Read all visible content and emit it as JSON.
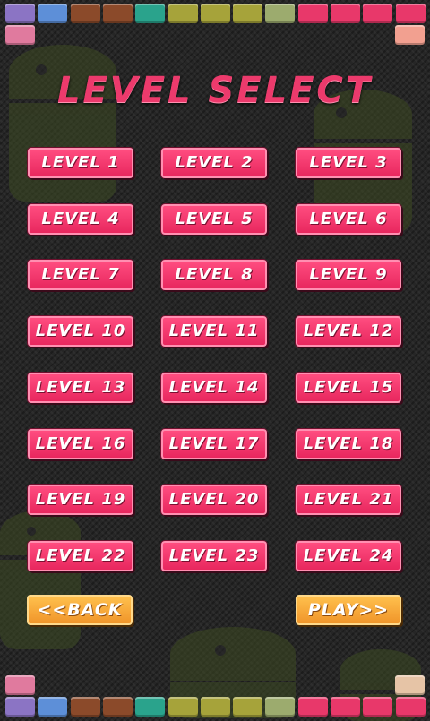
{
  "title": "LEVEL SELECT",
  "levels": [
    "LEVEL 1",
    "LEVEL 2",
    "LEVEL 3",
    "LEVEL 4",
    "LEVEL 5",
    "LEVEL 6",
    "LEVEL 7",
    "LEVEL 8",
    "LEVEL 9",
    "LEVEL 10",
    "LEVEL 11",
    "LEVEL 12",
    "LEVEL 13",
    "LEVEL 14",
    "LEVEL 15",
    "LEVEL 16",
    "LEVEL 17",
    "LEVEL 18",
    "LEVEL 19",
    "LEVEL 20",
    "LEVEL 21",
    "LEVEL 22",
    "LEVEL 23",
    "LEVEL 24"
  ],
  "back_label": "<<BACK",
  "play_label": "PLAY>>",
  "colors": {
    "level_button": "#f23a6e",
    "nav_button": "#f5a63a",
    "title": "#ec3a6c",
    "background": "#262626"
  },
  "brick_colors_top": [
    "#8b74c4",
    "#5d8fd8",
    "#8b4a2a",
    "#8b4a2a",
    "#2aa38c",
    "#a6a33a",
    "#a6a33a",
    "#a6a33a",
    "#9cab6e",
    "#e8386a",
    "#e8386a",
    "#e8386a",
    "#e8386a"
  ],
  "brick_colors_bottom": [
    "#8b74c4",
    "#5d8fd8",
    "#8b4a2a",
    "#8b4a2a",
    "#2aa38c",
    "#a6a33a",
    "#a6a33a",
    "#a6a33a",
    "#9cab6e",
    "#e8386a",
    "#e8386a",
    "#e8386a",
    "#e8386a"
  ],
  "side_bricks": {
    "top_left": "#e07a9e",
    "top_right": "#f2a090",
    "bottom_left": "#e07a9e",
    "bottom_right": "#e6c4a6"
  }
}
